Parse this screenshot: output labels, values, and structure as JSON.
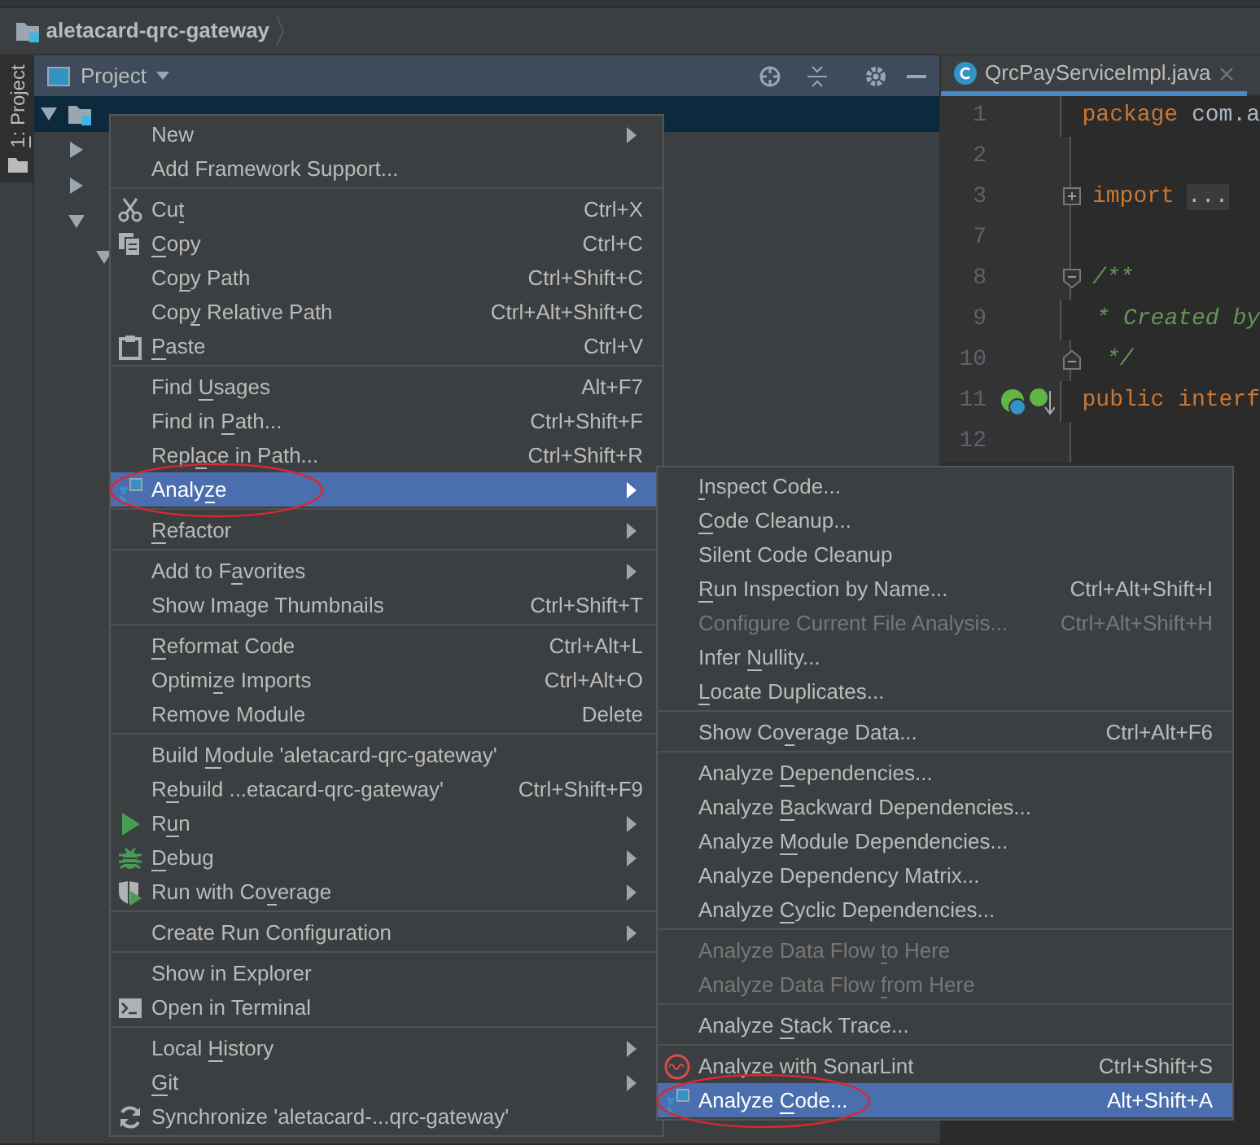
{
  "breadcrumb": {
    "title": "aletacard-qrc-gateway"
  },
  "tool_strip": {
    "parts": [
      {
        "text": "1",
        "underlined": true
      },
      {
        "text": ": Project",
        "underlined": false
      }
    ]
  },
  "project_panel": {
    "title": "Project",
    "tree": [
      {
        "expanded": true,
        "selected": true,
        "children": [
          {
            "expanded": false,
            "selected": false
          },
          {
            "expanded": false,
            "selected": false
          },
          {
            "expanded": true,
            "selected": false,
            "children": [
              {
                "expanded": true,
                "selected": false
              }
            ]
          }
        ]
      }
    ]
  },
  "editor": {
    "tabs": [
      {
        "label": "QrcPayServiceImpl.java",
        "selected": true
      }
    ],
    "lines": [
      {
        "number": "1",
        "tokens": [
          {
            "kind": "keyword",
            "text": "package"
          },
          {
            "kind": "plain",
            "text": " com.a"
          }
        ]
      },
      {
        "number": "2"
      },
      {
        "number": "3",
        "fold": {
          "kind": "expand"
        },
        "tokens": [
          {
            "kind": "keyword",
            "text": "import"
          },
          {
            "kind": "folded",
            "text": "..."
          }
        ]
      },
      {
        "number": "7"
      },
      {
        "number": "8",
        "fold": {
          "kind": "start"
        },
        "tokens": [
          {
            "kind": "comment",
            "text": "/**"
          }
        ]
      },
      {
        "number": "9",
        "tokens": [
          {
            "kind": "comment",
            "text": " * Created by"
          }
        ]
      },
      {
        "number": "10",
        "fold": {
          "kind": "end"
        },
        "tokens": [
          {
            "kind": "comment",
            "text": " */"
          }
        ]
      },
      {
        "number": "11",
        "gutter": true,
        "tokens": [
          {
            "kind": "keyword",
            "text": "public interf"
          }
        ]
      },
      {
        "number": "12"
      }
    ]
  },
  "context_menu": {
    "items": [
      {
        "kind": "item",
        "label": "New",
        "submenu": true,
        "selected": false,
        "disabled": false
      },
      {
        "kind": "item",
        "label": "Add Framework Support...",
        "selected": false,
        "disabled": false
      },
      {
        "kind": "separator"
      },
      {
        "kind": "item",
        "parts": [
          {
            "text": "Cu",
            "underlined": false
          },
          {
            "text": "t",
            "underlined": true
          }
        ],
        "shortcut": "Ctrl+X",
        "selected": false,
        "disabled": false
      },
      {
        "kind": "item",
        "parts": [
          {
            "text": "C",
            "underlined": true
          },
          {
            "text": "opy",
            "underlined": false
          }
        ],
        "shortcut": "Ctrl+C",
        "selected": false,
        "disabled": false
      },
      {
        "kind": "item",
        "parts": [
          {
            "text": "Co",
            "underlined": false
          },
          {
            "text": "p",
            "underlined": true
          },
          {
            "text": "y Path",
            "underlined": false
          }
        ],
        "shortcut": "Ctrl+Shift+C",
        "selected": false,
        "disabled": false
      },
      {
        "kind": "item",
        "parts": [
          {
            "text": "Cop",
            "underlined": false
          },
          {
            "text": "y",
            "underlined": true
          },
          {
            "text": " Relative Path",
            "underlined": false
          }
        ],
        "shortcut": "Ctrl+Alt+Shift+C",
        "selected": false,
        "disabled": false
      },
      {
        "kind": "item",
        "parts": [
          {
            "text": "P",
            "underlined": true
          },
          {
            "text": "aste",
            "underlined": false
          }
        ],
        "shortcut": "Ctrl+V",
        "selected": false,
        "disabled": false
      },
      {
        "kind": "separator"
      },
      {
        "kind": "item",
        "parts": [
          {
            "text": "Find ",
            "underlined": false
          },
          {
            "text": "U",
            "underlined": true
          },
          {
            "text": "sages",
            "underlined": false
          }
        ],
        "shortcut": "Alt+F7",
        "selected": false,
        "disabled": false
      },
      {
        "kind": "item",
        "parts": [
          {
            "text": "Find in ",
            "underlined": false
          },
          {
            "text": "P",
            "underlined": true
          },
          {
            "text": "ath...",
            "underlined": false
          }
        ],
        "shortcut": "Ctrl+Shift+F",
        "selected": false,
        "disabled": false
      },
      {
        "kind": "item",
        "parts": [
          {
            "text": "Repl",
            "underlined": false
          },
          {
            "text": "a",
            "underlined": true
          },
          {
            "text": "ce in Path...",
            "underlined": false
          }
        ],
        "shortcut": "Ctrl+Shift+R",
        "selected": false,
        "disabled": false
      },
      {
        "kind": "item",
        "parts": [
          {
            "text": "Analy",
            "underlined": false
          },
          {
            "text": "z",
            "underlined": true
          },
          {
            "text": "e",
            "underlined": false
          }
        ],
        "submenu": true,
        "selected": true,
        "disabled": false,
        "circled": true
      },
      {
        "kind": "separator"
      },
      {
        "kind": "item",
        "parts": [
          {
            "text": "R",
            "underlined": true
          },
          {
            "text": "efactor",
            "underlined": false
          }
        ],
        "submenu": true,
        "selected": false,
        "disabled": false
      },
      {
        "kind": "separator"
      },
      {
        "kind": "item",
        "parts": [
          {
            "text": "Add to F",
            "underlined": false
          },
          {
            "text": "a",
            "underlined": true
          },
          {
            "text": "vorites",
            "underlined": false
          }
        ],
        "submenu": true,
        "selected": false,
        "disabled": false
      },
      {
        "kind": "item",
        "label": "Show Image Thumbnails",
        "shortcut": "Ctrl+Shift+T",
        "selected": false,
        "disabled": false
      },
      {
        "kind": "separator"
      },
      {
        "kind": "item",
        "parts": [
          {
            "text": "R",
            "underlined": true
          },
          {
            "text": "eformat Code",
            "underlined": false
          }
        ],
        "shortcut": "Ctrl+Alt+L",
        "selected": false,
        "disabled": false
      },
      {
        "kind": "item",
        "parts": [
          {
            "text": "Optimi",
            "underlined": false
          },
          {
            "text": "z",
            "underlined": true
          },
          {
            "text": "e Imports",
            "underlined": false
          }
        ],
        "shortcut": "Ctrl+Alt+O",
        "selected": false,
        "disabled": false
      },
      {
        "kind": "item",
        "label": "Remove Module",
        "shortcut": "Delete",
        "selected": false,
        "disabled": false
      },
      {
        "kind": "separator"
      },
      {
        "kind": "item",
        "parts": [
          {
            "text": "Build ",
            "underlined": false
          },
          {
            "text": "M",
            "underlined": true
          },
          {
            "text": "odule 'aletacard-qrc-gateway'",
            "underlined": false
          }
        ],
        "selected": false,
        "disabled": false
      },
      {
        "kind": "item",
        "parts": [
          {
            "text": "R",
            "underlined": false
          },
          {
            "text": "e",
            "underlined": true
          },
          {
            "text": "build ...etacard-qrc-gateway'",
            "underlined": false
          }
        ],
        "shortcut": "Ctrl+Shift+F9",
        "selected": false,
        "disabled": false
      },
      {
        "kind": "item",
        "parts": [
          {
            "text": "R",
            "underlined": false
          },
          {
            "text": "u",
            "underlined": true
          },
          {
            "text": "n",
            "underlined": false
          }
        ],
        "submenu": true,
        "selected": false,
        "disabled": false
      },
      {
        "kind": "item",
        "parts": [
          {
            "text": "D",
            "underlined": true
          },
          {
            "text": "ebug",
            "underlined": false
          }
        ],
        "submenu": true,
        "selected": false,
        "disabled": false
      },
      {
        "kind": "item",
        "parts": [
          {
            "text": "Run with Co",
            "underlined": false
          },
          {
            "text": "v",
            "underlined": true
          },
          {
            "text": "erage",
            "underlined": false
          }
        ],
        "submenu": true,
        "selected": false,
        "disabled": false
      },
      {
        "kind": "separator"
      },
      {
        "kind": "item",
        "label": "Create Run Configuration",
        "submenu": true,
        "selected": false,
        "disabled": false
      },
      {
        "kind": "separator"
      },
      {
        "kind": "item",
        "label": "Show in Explorer",
        "selected": false,
        "disabled": false
      },
      {
        "kind": "item",
        "label": "Open in Terminal",
        "selected": false,
        "disabled": false
      },
      {
        "kind": "separator"
      },
      {
        "kind": "item",
        "parts": [
          {
            "text": "Local ",
            "underlined": false
          },
          {
            "text": "H",
            "underlined": true
          },
          {
            "text": "istory",
            "underlined": false
          }
        ],
        "submenu": true,
        "selected": false,
        "disabled": false
      },
      {
        "kind": "item",
        "parts": [
          {
            "text": "G",
            "underlined": true
          },
          {
            "text": "it",
            "underlined": false
          }
        ],
        "submenu": true,
        "selected": false,
        "disabled": false
      },
      {
        "kind": "item",
        "label": "Synchronize 'aletacard-...qrc-gateway'",
        "selected": false,
        "disabled": false
      }
    ]
  },
  "analyze_submenu": {
    "items": [
      {
        "kind": "item",
        "parts": [
          {
            "text": "I",
            "underlined": true
          },
          {
            "text": "nspect Code...",
            "underlined": false
          }
        ],
        "selected": false,
        "disabled": false
      },
      {
        "kind": "item",
        "parts": [
          {
            "text": "C",
            "underlined": true
          },
          {
            "text": "ode Cleanup...",
            "underlined": false
          }
        ],
        "selected": false,
        "disabled": false
      },
      {
        "kind": "item",
        "label": "Silent Code Cleanup",
        "selected": false,
        "disabled": false
      },
      {
        "kind": "item",
        "parts": [
          {
            "text": "R",
            "underlined": true
          },
          {
            "text": "un Inspection by Name...",
            "underlined": false
          }
        ],
        "shortcut": "Ctrl+Alt+Shift+I",
        "selected": false,
        "disabled": false
      },
      {
        "kind": "item",
        "label": "Configure Current File Analysis...",
        "shortcut": "Ctrl+Alt+Shift+H",
        "selected": false,
        "disabled": true
      },
      {
        "kind": "item",
        "parts": [
          {
            "text": "Infer ",
            "underlined": false
          },
          {
            "text": "N",
            "underlined": true
          },
          {
            "text": "ullity...",
            "underlined": false
          }
        ],
        "selected": false,
        "disabled": false
      },
      {
        "kind": "item",
        "parts": [
          {
            "text": "L",
            "underlined": true
          },
          {
            "text": "ocate Duplicates...",
            "underlined": false
          }
        ],
        "selected": false,
        "disabled": false
      },
      {
        "kind": "separator"
      },
      {
        "kind": "item",
        "parts": [
          {
            "text": "Show Co",
            "underlined": false
          },
          {
            "text": "v",
            "underlined": true
          },
          {
            "text": "erage Data...",
            "underlined": false
          }
        ],
        "shortcut": "Ctrl+Alt+F6",
        "selected": false,
        "disabled": false
      },
      {
        "kind": "separator"
      },
      {
        "kind": "item",
        "parts": [
          {
            "text": "Analyze ",
            "underlined": false
          },
          {
            "text": "D",
            "underlined": true
          },
          {
            "text": "ependencies...",
            "underlined": false
          }
        ],
        "selected": false,
        "disabled": false
      },
      {
        "kind": "item",
        "parts": [
          {
            "text": "Analyze ",
            "underlined": false
          },
          {
            "text": "B",
            "underlined": true
          },
          {
            "text": "ackward Dependencies...",
            "underlined": false
          }
        ],
        "selected": false,
        "disabled": false
      },
      {
        "kind": "item",
        "parts": [
          {
            "text": "Analyze ",
            "underlined": false
          },
          {
            "text": "M",
            "underlined": true
          },
          {
            "text": "odule Dependencies...",
            "underlined": false
          }
        ],
        "selected": false,
        "disabled": false
      },
      {
        "kind": "item",
        "label": "Analyze Dependency Matrix...",
        "selected": false,
        "disabled": false
      },
      {
        "kind": "item",
        "parts": [
          {
            "text": "Analyze ",
            "underlined": false
          },
          {
            "text": "C",
            "underlined": true
          },
          {
            "text": "yclic Dependencies...",
            "underlined": false
          }
        ],
        "selected": false,
        "disabled": false
      },
      {
        "kind": "separator"
      },
      {
        "kind": "item",
        "parts": [
          {
            "text": "Analyze Data Flow ",
            "underlined": false
          },
          {
            "text": "t",
            "underlined": true
          },
          {
            "text": "o Here",
            "underlined": false
          }
        ],
        "selected": false,
        "disabled": true
      },
      {
        "kind": "item",
        "parts": [
          {
            "text": "Analyze Data Flow ",
            "underlined": false
          },
          {
            "text": "f",
            "underlined": true
          },
          {
            "text": "rom Here",
            "underlined": false
          }
        ],
        "selected": false,
        "disabled": true
      },
      {
        "kind": "separator"
      },
      {
        "kind": "item",
        "parts": [
          {
            "text": "Analyze ",
            "underlined": false
          },
          {
            "text": "S",
            "underlined": true
          },
          {
            "text": "tack Trace...",
            "underlined": false
          }
        ],
        "selected": false,
        "disabled": false
      },
      {
        "kind": "separator"
      },
      {
        "kind": "item",
        "label": "Analyze with SonarLint",
        "shortcut": "Ctrl+Shift+S",
        "selected": false,
        "disabled": false
      },
      {
        "kind": "item",
        "parts": [
          {
            "text": "Analyze ",
            "underlined": false
          },
          {
            "text": "C",
            "underlined": true
          },
          {
            "text": "ode...",
            "underlined": false
          }
        ],
        "shortcut": "Alt+Shift+A",
        "selected": true,
        "disabled": false,
        "circled": true
      }
    ]
  }
}
